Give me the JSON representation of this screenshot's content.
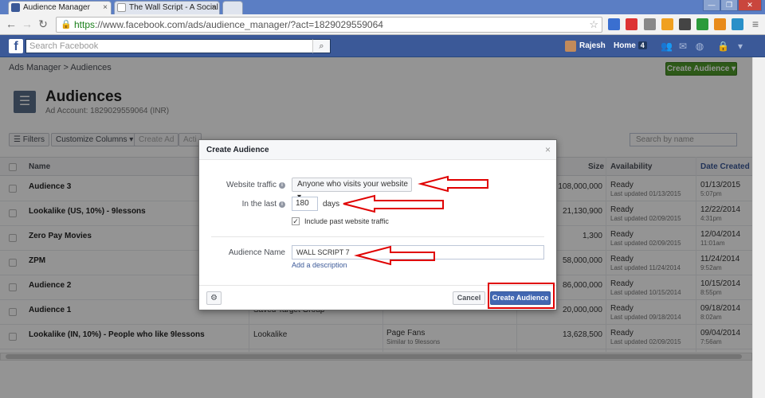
{
  "browser": {
    "tabs": [
      {
        "label": "Audience Manager"
      },
      {
        "label": "The Wall Script - A Social"
      }
    ],
    "url_scheme": "https",
    "url_rest": "://www.facebook.com/ads/audience_manager/?act=1829029559064"
  },
  "fb": {
    "logo": "f",
    "search_placeholder": "Search Facebook",
    "user": "Rajesh",
    "home": "Home",
    "home_count": "4"
  },
  "page": {
    "breadcrumb": "Ads Manager  >  Audiences",
    "create_button": "Create Audience ▾",
    "title": "Audiences",
    "account": "Ad Account: 1829029559064 (INR)",
    "toolbar": {
      "filters": "☰ Filters",
      "customize": "Customize Columns ▾",
      "create_ad": "Create Ad",
      "actions": "Acti"
    },
    "search_name_placeholder": "Search by name"
  },
  "table": {
    "headers": {
      "name": "Name",
      "size": "Size",
      "availability": "Availability",
      "date_created": "Date Created"
    },
    "rows": [
      {
        "name": "Audience 3",
        "type": "",
        "source": "",
        "source_sub": "",
        "size": "108,000,000",
        "status": "Ready",
        "updated": "Last updated 01/13/2015",
        "date": "01/13/2015",
        "time": "5:07pm"
      },
      {
        "name": "Lookalike (US, 10%) - 9lessons",
        "type": "",
        "source": "",
        "source_sub": "",
        "size": "21,130,900",
        "status": "Ready",
        "updated": "Last updated 02/09/2015",
        "date": "12/22/2014",
        "time": "4:31pm"
      },
      {
        "name": "Zero Pay Movies",
        "type": "",
        "source": "",
        "source_sub": "",
        "size": "1,300",
        "status": "Ready",
        "updated": "Last updated 02/09/2015",
        "date": "12/04/2014",
        "time": "11:01am"
      },
      {
        "name": "ZPM",
        "type": "",
        "source": "",
        "source_sub": "",
        "size": "58,000,000",
        "status": "Ready",
        "updated": "Last updated 11/24/2014",
        "date": "11/24/2014",
        "time": "9:52am"
      },
      {
        "name": "Audience 2",
        "type": "",
        "source": "",
        "source_sub": "",
        "size": "86,000,000",
        "status": "Ready",
        "updated": "Last updated 10/15/2014",
        "date": "10/15/2014",
        "time": "8:55pm"
      },
      {
        "name": "Audience 1",
        "type": "Saved Target Group",
        "source": "",
        "source_sub": "",
        "size": "20,000,000",
        "status": "Ready",
        "updated": "Last updated 09/18/2014",
        "date": "09/18/2014",
        "time": "8:02am"
      },
      {
        "name": "Lookalike (IN, 10%) - People who like 9lessons",
        "type": "Lookalike",
        "source": "Page Fans",
        "source_sub": "Similar to 9lessons",
        "size": "13,628,500",
        "status": "Ready",
        "updated": "Last updated 02/09/2015",
        "date": "09/04/2014",
        "time": "7:56am"
      }
    ]
  },
  "dialog": {
    "title": "Create Audience",
    "close": "×",
    "website_traffic_label": "Website traffic",
    "website_traffic_value": "Anyone who visits your website  ▾",
    "in_the_last_label": "In the last",
    "in_the_last_value": "180",
    "days": "days",
    "include_past": "Include past website traffic",
    "include_past_check": "✓",
    "audience_name_label": "Audience Name",
    "audience_name_value": "WALL SCRIPT 7",
    "add_description": "Add a description",
    "gear": "⚙",
    "cancel": "Cancel",
    "create": "Create Audience"
  },
  "colors": {
    "fb_blue": "#3b5998",
    "create_green": "#4e9a2a",
    "primary_button": "#4267b2",
    "annotation_red": "#e00000"
  }
}
